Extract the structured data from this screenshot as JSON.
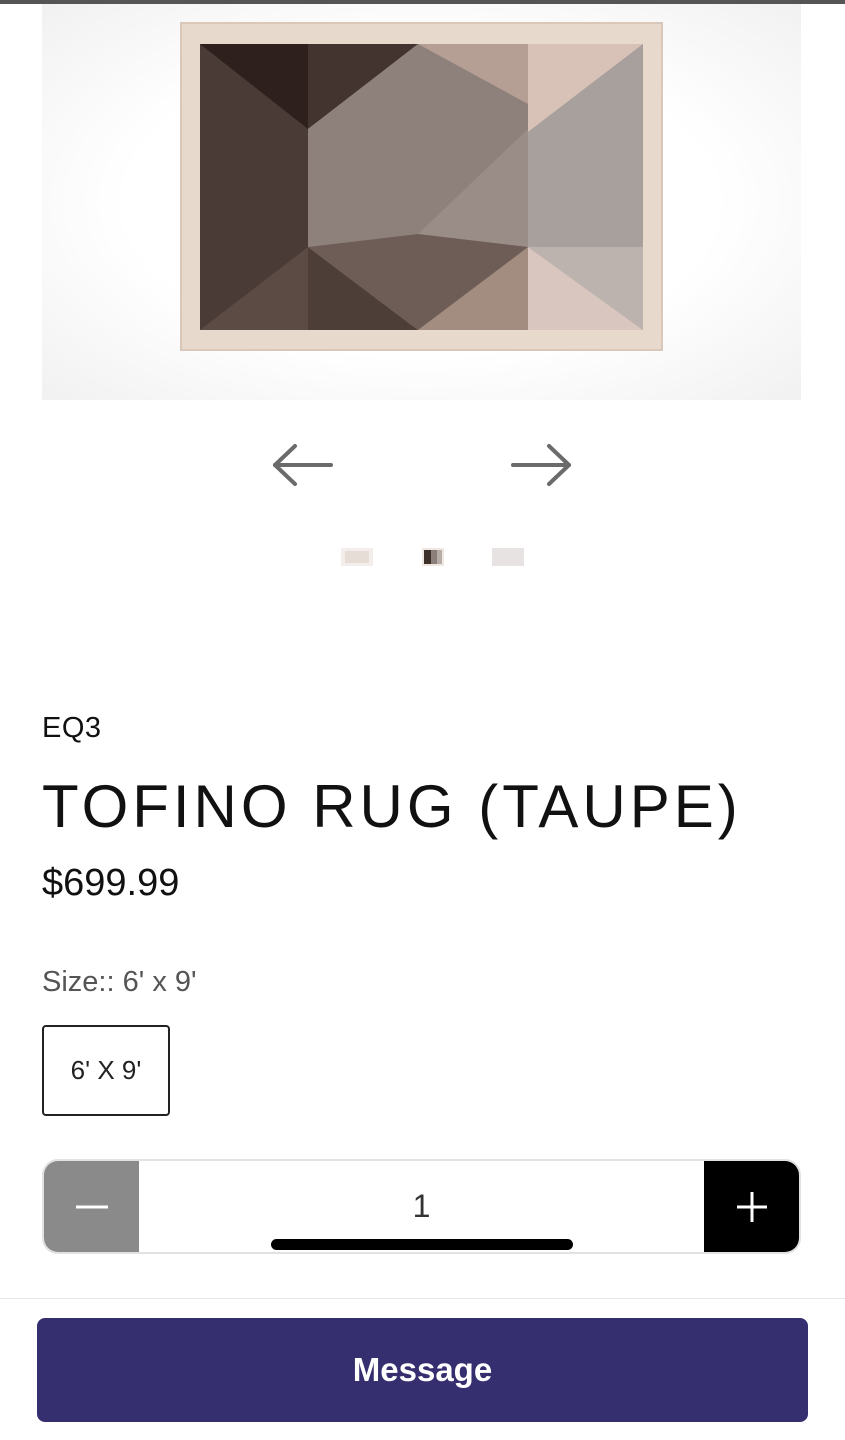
{
  "product": {
    "brand": "EQ3",
    "title": "TOFINO RUG (TAUPE)",
    "price": "$699.99"
  },
  "gallery": {
    "prev_icon": "arrow-left-icon",
    "next_icon": "arrow-right-icon",
    "thumbnail_count": 3,
    "active_thumbnail": 2
  },
  "size": {
    "label": "Size::",
    "selected_value": "6' x 9'",
    "options": [
      "6' X 9'"
    ]
  },
  "quantity": {
    "value": "1",
    "minus_icon": "minus-icon",
    "plus_icon": "plus-icon"
  },
  "actions": {
    "message_label": "Message"
  },
  "colors": {
    "message_button": "#352f70",
    "qty_minus_bg": "#8a8a8a",
    "qty_plus_bg": "#000000"
  }
}
